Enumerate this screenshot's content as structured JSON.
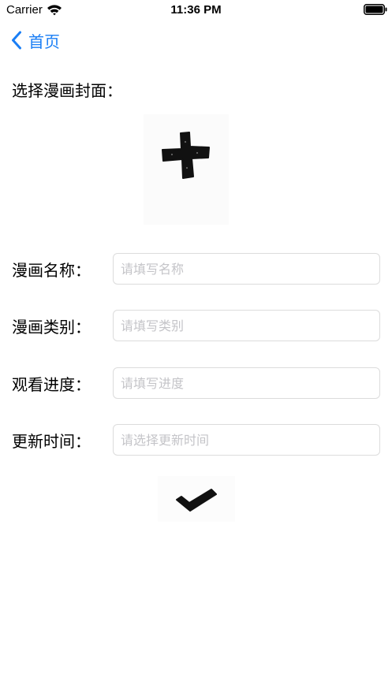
{
  "status_bar": {
    "carrier": "Carrier",
    "time": "11:36 PM",
    "wifi_icon": "wifi-icon",
    "battery_icon": "battery-full-icon"
  },
  "nav": {
    "back_label": "首页",
    "back_icon": "chevron-left-icon",
    "accent_color": "#1a7ef5"
  },
  "cover": {
    "label": "选择漫画封面：",
    "icon": "plus-icon"
  },
  "form": {
    "name": {
      "label": "漫画名称：",
      "placeholder": "请填写名称",
      "value": ""
    },
    "category": {
      "label": "漫画类别：",
      "placeholder": "请填写类别",
      "value": ""
    },
    "progress": {
      "label": "观看进度：",
      "placeholder": "请填写进度",
      "value": ""
    },
    "update_time": {
      "label": "更新时间：",
      "placeholder": "请选择更新时间",
      "value": ""
    }
  },
  "submit": {
    "icon": "checkmark-icon"
  }
}
